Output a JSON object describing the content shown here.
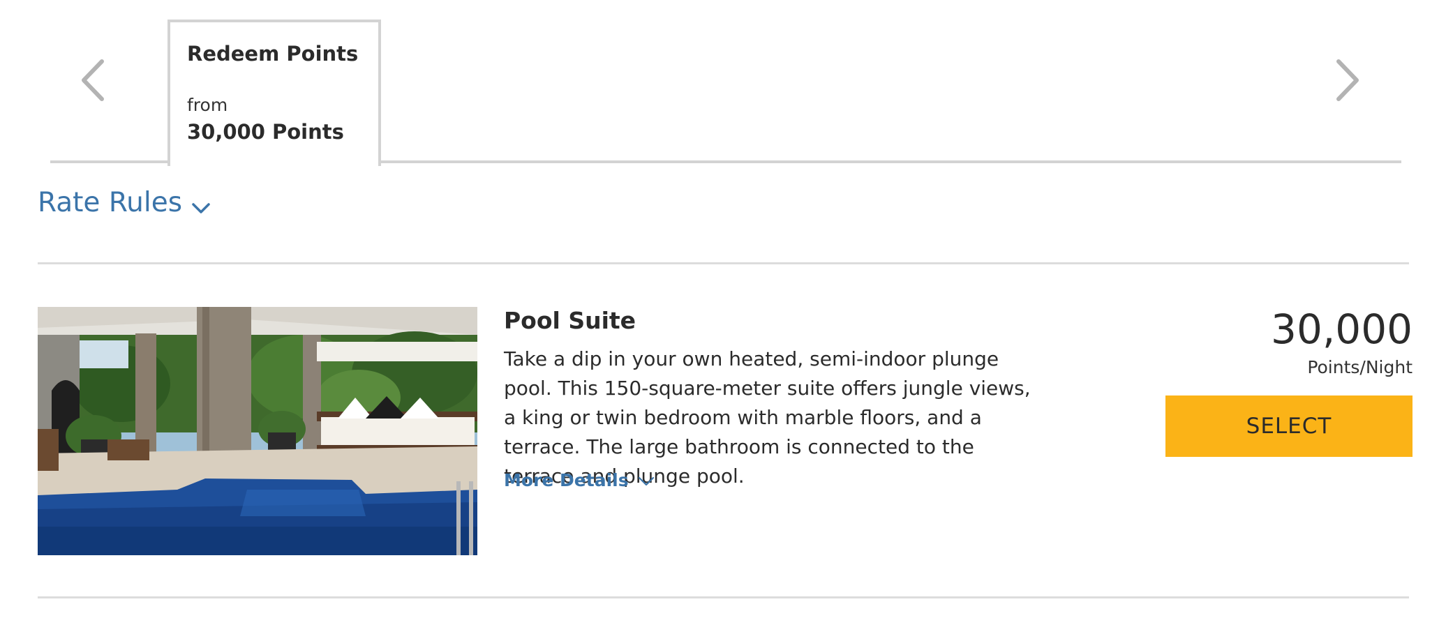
{
  "rate_tabs": {
    "prev_icon": "chevron-left-icon",
    "next_icon": "chevron-right-icon",
    "items": [
      {
        "title": "Redeem Points",
        "from_label": "from",
        "price": "30,000 Points",
        "selected": true
      }
    ]
  },
  "rate_rules": {
    "label": "Rate Rules",
    "icon": "chevron-down-icon"
  },
  "room": {
    "name": "Pool Suite",
    "description": "Take a dip in your own heated, semi-indoor plunge pool. This 150-square-meter suite offers jungle views, a king or twin bedroom with marble floors, and a terrace. The large bathroom is connected to the terrace and plunge pool.",
    "more_details_label": "More Details",
    "more_details_icon": "chevron-down-icon",
    "photo_icon": "room-photo",
    "price": "30,000",
    "price_unit": "Points/Night",
    "select_label": "SELECT"
  },
  "colors": {
    "link": "#3b74a9",
    "select_button": "#fbb317",
    "border": "#d3d3d3",
    "text": "#2b2b2b"
  }
}
